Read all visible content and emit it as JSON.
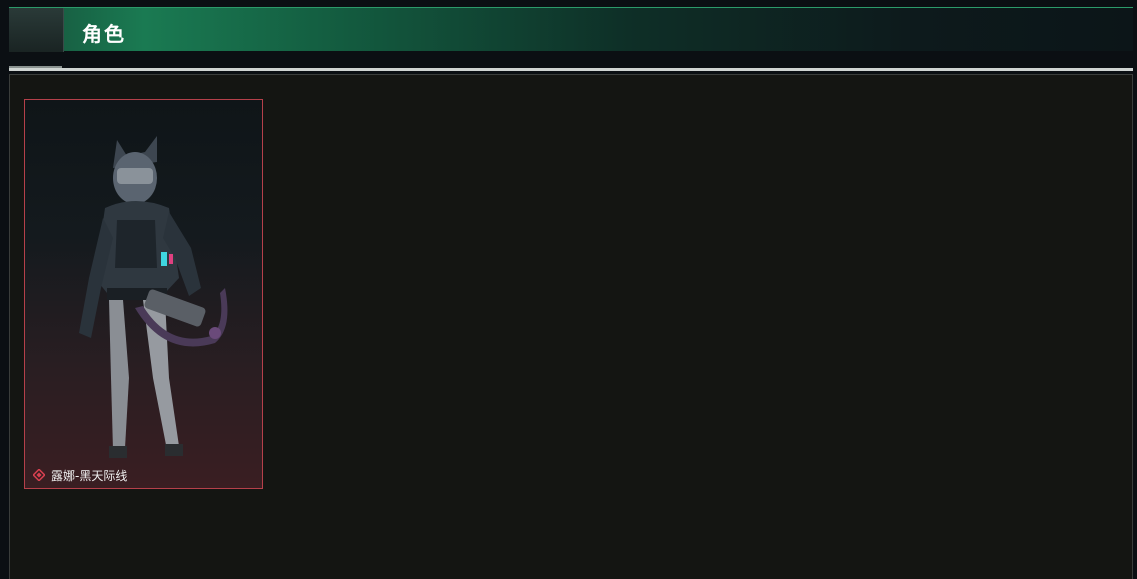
{
  "header": {
    "title": "角色"
  },
  "characters": [
    {
      "name": "露娜-黑天际线",
      "icon": "rarity-diamond-icon",
      "accent_color": "#b5404a",
      "selected": true
    }
  ],
  "colors": {
    "header_green": "#1a7a52",
    "panel_bg": "#141512",
    "card_border": "#b5404a"
  }
}
